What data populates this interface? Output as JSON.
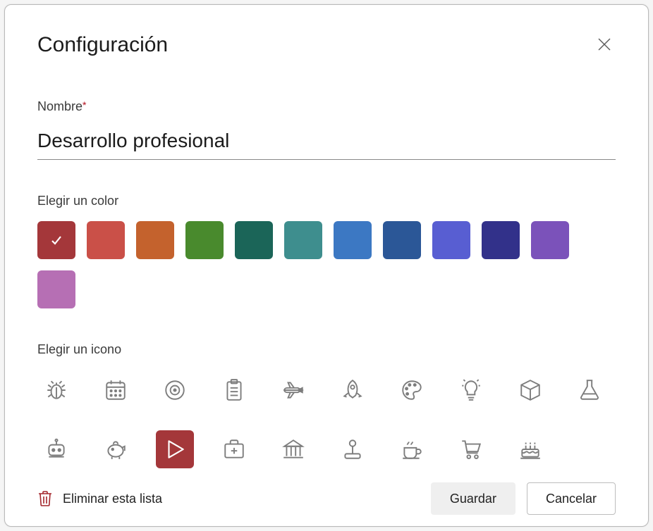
{
  "dialog": {
    "title": "Configuración",
    "name_label": "Nombre",
    "name_value": "Desarrollo profesional",
    "color_label": "Elegir un color",
    "icon_label": "Elegir un icono",
    "delete_label": "Eliminar esta lista",
    "save_label": "Guardar",
    "cancel_label": "Cancelar"
  },
  "colors": [
    {
      "name": "dark-red",
      "hex": "#a4373a",
      "selected": true
    },
    {
      "name": "red",
      "hex": "#ca5048",
      "selected": false
    },
    {
      "name": "orange",
      "hex": "#c4622d",
      "selected": false
    },
    {
      "name": "green",
      "hex": "#498a2d",
      "selected": false
    },
    {
      "name": "teal-dark",
      "hex": "#1b6558",
      "selected": false
    },
    {
      "name": "teal",
      "hex": "#3e8e8e",
      "selected": false
    },
    {
      "name": "blue",
      "hex": "#3c78c3",
      "selected": false
    },
    {
      "name": "blue-dark",
      "hex": "#2b5797",
      "selected": false
    },
    {
      "name": "indigo",
      "hex": "#585ed2",
      "selected": false
    },
    {
      "name": "navy",
      "hex": "#32318a",
      "selected": false
    },
    {
      "name": "purple",
      "hex": "#7b52ba",
      "selected": false
    },
    {
      "name": "violet",
      "hex": "#b66fb4",
      "selected": false
    }
  ],
  "icons": [
    {
      "name": "bug-icon",
      "selected": false
    },
    {
      "name": "calendar-icon",
      "selected": false
    },
    {
      "name": "target-icon",
      "selected": false
    },
    {
      "name": "clipboard-icon",
      "selected": false
    },
    {
      "name": "plane-icon",
      "selected": false
    },
    {
      "name": "rocket-icon",
      "selected": false
    },
    {
      "name": "palette-icon",
      "selected": false
    },
    {
      "name": "lightbulb-icon",
      "selected": false
    },
    {
      "name": "cube-icon",
      "selected": false
    },
    {
      "name": "flask-icon",
      "selected": false
    },
    {
      "name": "robot-icon",
      "selected": false
    },
    {
      "name": "piggy-bank-icon",
      "selected": false
    },
    {
      "name": "play-icon",
      "selected": true
    },
    {
      "name": "first-aid-icon",
      "selected": false
    },
    {
      "name": "bank-icon",
      "selected": false
    },
    {
      "name": "joystick-icon",
      "selected": false
    },
    {
      "name": "coffee-icon",
      "selected": false
    },
    {
      "name": "cart-icon",
      "selected": false
    },
    {
      "name": "cake-icon",
      "selected": false
    }
  ],
  "selected_color_hex": "#a4373a"
}
